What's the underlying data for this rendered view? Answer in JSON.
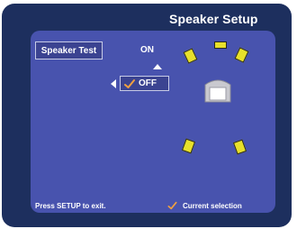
{
  "header": {
    "title": "Speaker Setup"
  },
  "menu": {
    "speaker_test_label": "Speaker Test",
    "options": [
      "ON",
      "OFF"
    ],
    "selected": "OFF"
  },
  "footer": {
    "hint": "Press SETUP to exit.",
    "legend": "Current selection"
  },
  "colors": {
    "outer_panel": "#1d2f5e",
    "inner_panel": "#4853ae",
    "speaker": "#e8e02a",
    "checkmark": "#f0a040",
    "text": "#ffffff"
  },
  "icons": {
    "check": "checkmark-icon",
    "up": "up-arrow-icon",
    "left": "left-arrow-icon",
    "speaker": "speaker-icon",
    "listener": "listener-seat-icon"
  }
}
